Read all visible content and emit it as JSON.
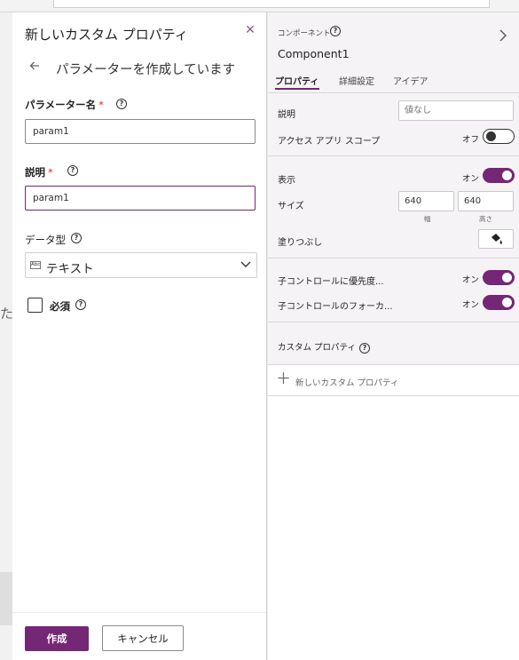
{
  "background": {
    "canvas_glyph": "た("
  },
  "dialog": {
    "title": "新しいカスタム プロパティ",
    "close_icon": "close-icon",
    "back_icon": "back-arrow-icon",
    "subtitle": "パラメーターを作成しています",
    "param_name": {
      "label": "パラメーター名",
      "required_mark": "*",
      "value": "param1"
    },
    "description": {
      "label": "説明",
      "required_mark": "*",
      "value": "param1"
    },
    "data_type": {
      "label": "データ型",
      "selected": "テキスト",
      "type_icon_text": "Abc"
    },
    "required_checkbox": {
      "label": "必須",
      "checked": false
    },
    "help_glyph": "?",
    "footer": {
      "create_label": "作成",
      "cancel_label": "キャンセル"
    }
  },
  "props_panel": {
    "caption": "コンポーネント",
    "component_name": "Component1",
    "tabs": [
      {
        "label": "プロパティ",
        "active": true
      },
      {
        "label": "詳細設定",
        "active": false
      },
      {
        "label": "アイデア",
        "active": false
      }
    ],
    "description": {
      "label": "説明",
      "placeholder": "値なし"
    },
    "access_app_scope": {
      "label": "アクセス アプリ スコープ",
      "state_text": "オフ",
      "on": false
    },
    "visible": {
      "label": "表示",
      "state_text": "オン",
      "on": true
    },
    "size": {
      "label": "サイズ",
      "width": "640",
      "height": "640",
      "width_caption": "幅",
      "height_caption": "高さ"
    },
    "fill": {
      "label": "塗りつぶし",
      "icon": "paint-bucket-icon"
    },
    "child_priority": {
      "label": "子コントロールに優先度...",
      "state_text": "オン",
      "on": true
    },
    "child_focus": {
      "label": "子コントロールのフォーカ...",
      "state_text": "オン",
      "on": true
    },
    "custom_properties": {
      "label": "カスタム プロパティ"
    },
    "new_custom_property": {
      "label": "新しいカスタム プロパティ"
    }
  },
  "colors": {
    "accent": "#742774",
    "required": "#c0392b"
  }
}
